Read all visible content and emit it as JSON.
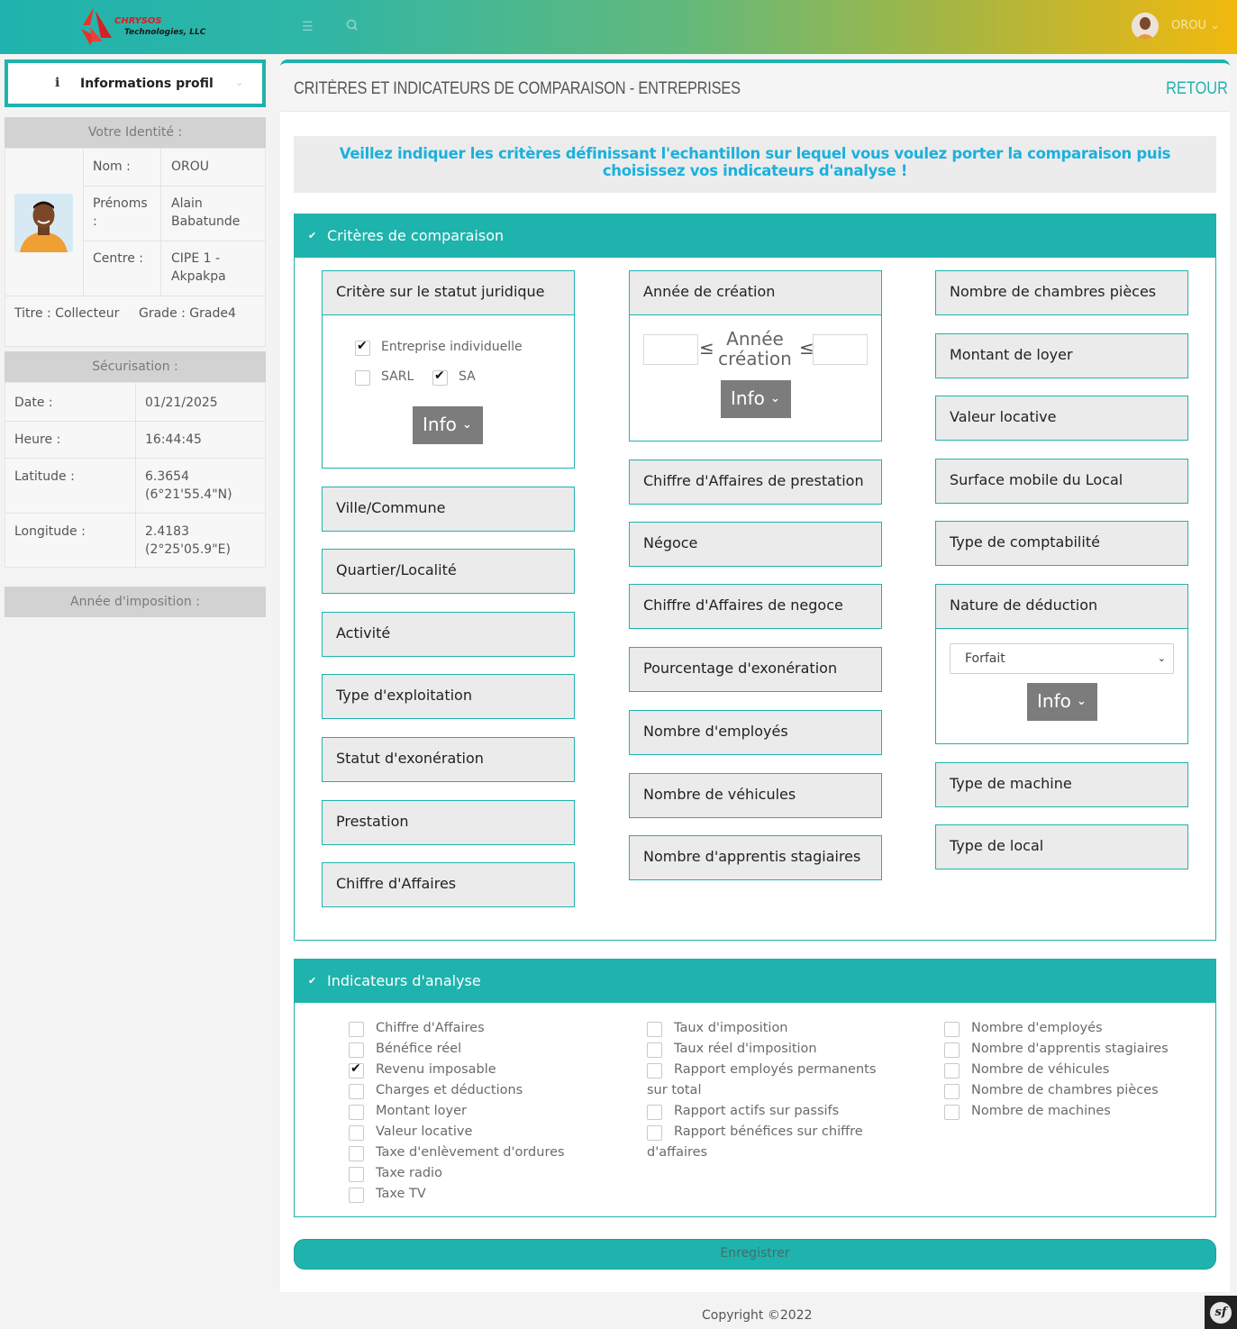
{
  "brand": {
    "name_line1": "CHRYSOS",
    "name_line2": "Technologies, LLC"
  },
  "topbar": {
    "user_name": "OROU ⌄"
  },
  "sidebar": {
    "profile_button": "Informations profil",
    "identity_header": "Votre Identité :",
    "identity": {
      "nom_label": "Nom :",
      "nom_value": "OROU",
      "prenoms_label1": "Prénoms",
      "prenoms_label2": ":",
      "prenoms_value1": "Alain",
      "prenoms_value2": "Babatunde",
      "centre_label": "Centre :",
      "centre_value1": "CIPE 1 -",
      "centre_value2": "Akpakpa",
      "titre": "Titre : Collecteur",
      "grade": "Grade : Grade4"
    },
    "security_header": "Sécurisation :",
    "security": {
      "date_label": "Date :",
      "date_value": "01/21/2025",
      "heure_label": "Heure :",
      "heure_value": "16:44:45",
      "lat_label": "Latitude :",
      "lat_value1": "6.3654",
      "lat_value2": "(6°21'55.4\"N)",
      "lon_label": "Longitude :",
      "lon_value1": "2.4183",
      "lon_value2": "(2°25'05.9\"E)"
    },
    "year_header": "Année d'imposition :"
  },
  "main": {
    "title": "CRITÈRES ET INDICATEURS DE COMPARAISON - ENTREPRISES",
    "back": "RETOUR",
    "alert": "Veillez indiquer les critères définissant l'echantillon sur lequel vous voulez porter la comparaison puis choisissez vos indicateurs d'analyse !",
    "criteria_header": "Critères de comparaison",
    "statut": {
      "title": "Critère sur le statut juridique",
      "options": [
        {
          "label": "Entreprise individuelle",
          "checked": true
        },
        {
          "label": "SARL",
          "checked": false
        },
        {
          "label": "SA",
          "checked": true
        }
      ]
    },
    "annee": {
      "title": "Année de création",
      "leq": "≤",
      "label1": "Année",
      "label2": "création"
    },
    "info_label": "Info",
    "col1": [
      "Ville/Commune",
      "Quartier/Localité",
      "Activité",
      "Type d'exploitation",
      "Statut d'exonération",
      "Prestation",
      "Chiffre d'Affaires"
    ],
    "col2": [
      "Chiffre d'Affaires de prestation",
      "Négoce",
      "Chiffre d'Affaires de negoce",
      "Pourcentage d'exonération",
      "Nombre d'employés",
      "Nombre de véhicules",
      "Nombre d'apprentis stagiaires"
    ],
    "col3_top": [
      "Nombre de chambres pièces",
      "Montant de loyer",
      "Valeur locative",
      "Surface mobile du Local",
      "Type de comptabilité"
    ],
    "deduction": {
      "title": "Nature de déduction",
      "selected": "Forfait"
    },
    "col3_bottom": [
      "Type de machine",
      "Type de local"
    ],
    "indicators_header": "Indicateurs d'analyse",
    "ind_col1": [
      {
        "label": "Chiffre d'Affaires",
        "checked": false
      },
      {
        "label": "Bénéfice réel",
        "checked": false
      },
      {
        "label": "Revenu imposable",
        "checked": true
      },
      {
        "label": "Charges et déductions",
        "checked": false
      },
      {
        "label": "Montant loyer",
        "checked": false
      },
      {
        "label": "Valeur locative",
        "checked": false
      },
      {
        "label": "Taxe d'enlèvement d'ordures",
        "checked": false
      },
      {
        "label": "Taxe radio",
        "checked": false
      },
      {
        "label": "Taxe TV",
        "checked": false
      }
    ],
    "ind_col2": [
      {
        "label": "Taux d'imposition",
        "checked": false
      },
      {
        "label": "Taux réel d'imposition",
        "checked": false
      },
      {
        "label": "Rapport employés permanents",
        "label_cont": "sur total",
        "checked": false
      },
      {
        "label": "Rapport actifs sur passifs",
        "checked": false
      },
      {
        "label": "Rapport bénéfices sur chiffre",
        "label_cont": "d'affaires",
        "checked": false
      }
    ],
    "ind_col3": [
      {
        "label": "Nombre d'employés",
        "checked": false
      },
      {
        "label": "Nombre d'apprentis stagiaires",
        "checked": false
      },
      {
        "label": "Nombre de véhicules",
        "checked": false
      },
      {
        "label": "Nombre de chambres pièces",
        "checked": false
      },
      {
        "label": "Nombre de machines",
        "checked": false
      }
    ],
    "save": "Enregistrer"
  },
  "footer": {
    "copyright": "Copyright ©2022"
  },
  "colors": {
    "accent": "#1fb3ad",
    "alert_text": "#1cb0dd",
    "info_button": "#7c7c7c"
  }
}
